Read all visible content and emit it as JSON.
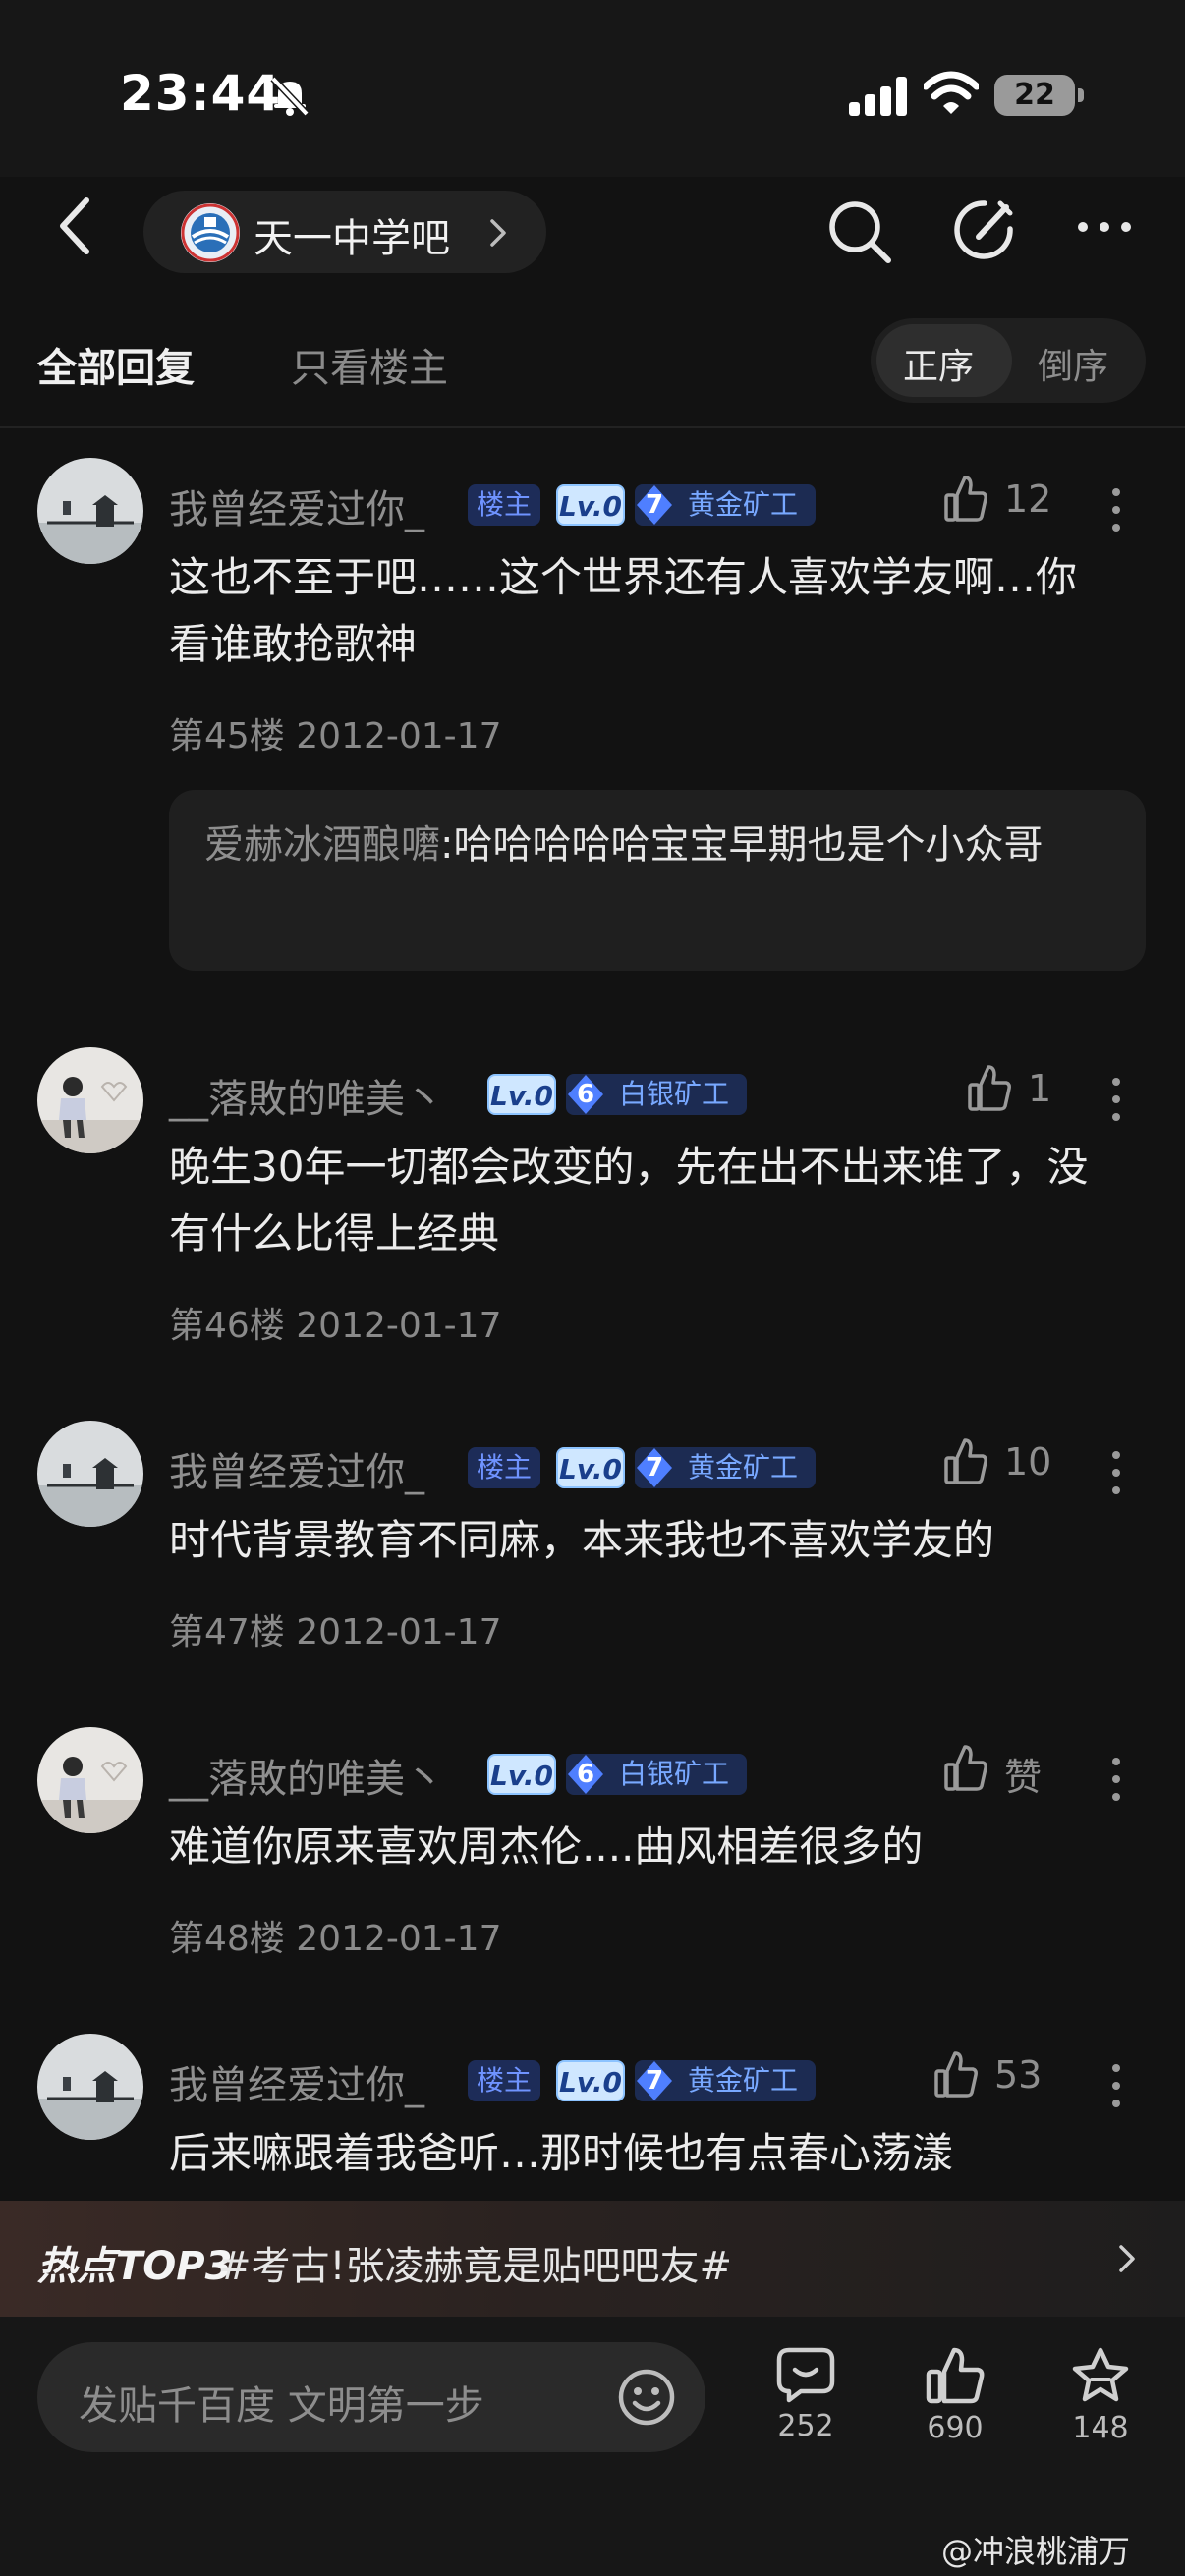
{
  "status_bar": {
    "time": "23:44",
    "battery": "22"
  },
  "header": {
    "forum_name": "天一中学吧"
  },
  "tabs": {
    "all_replies": "全部回复",
    "only_op": "只看楼主",
    "sort_asc": "正序",
    "sort_desc": "倒序",
    "active_sort": "正序"
  },
  "posts": [
    {
      "user": "我曾经爱过你_",
      "is_op": true,
      "op_badge": "楼主",
      "level": "Lv.0",
      "rank_num": "7",
      "rank_name": "黄金矿工",
      "likes": "12",
      "content": "这也不至于吧……这个世界还有人喜欢学友啊…你看谁敢抢歌神",
      "floor": "第45楼",
      "date": "2012-01-17",
      "sub_reply": {
        "user": "爱赫冰酒酿嚰",
        "sep": ":",
        "text": "哈哈哈哈哈宝宝早期也是个小众哥"
      }
    },
    {
      "user": "__落敗的唯美丶",
      "is_op": false,
      "level": "Lv.0",
      "rank_num": "6",
      "rank_name": "白银矿工",
      "likes": "1",
      "content": "晚生30年一切都会改变的，先在出不出来谁了，没有什么比得上经典",
      "floor": "第46楼",
      "date": "2012-01-17"
    },
    {
      "user": "我曾经爱过你_",
      "is_op": true,
      "op_badge": "楼主",
      "level": "Lv.0",
      "rank_num": "7",
      "rank_name": "黄金矿工",
      "likes": "10",
      "content": "时代背景教育不同麻，本来我也不喜欢学友的",
      "floor": "第47楼",
      "date": "2012-01-17"
    },
    {
      "user": "__落敗的唯美丶",
      "is_op": false,
      "level": "Lv.0",
      "rank_num": "6",
      "rank_name": "白银矿工",
      "likes": "赞",
      "content": "难道你原来喜欢周杰伦....曲风相差很多的",
      "floor": "第48楼",
      "date": "2012-01-17"
    },
    {
      "user": "我曾经爱过你_",
      "is_op": true,
      "op_badge": "楼主",
      "level": "Lv.0",
      "rank_num": "7",
      "rank_name": "黄金矿工",
      "likes": "53",
      "content": "后来嘛跟着我爸听…那时候也有点春心荡漾"
    }
  ],
  "hot_banner": {
    "tag": "热点TOP3",
    "title": "#考古!张凌赫竟是贴吧吧友#"
  },
  "bottom_bar": {
    "input_placeholder": "发贴千百度 文明第一步",
    "comments_count": "252",
    "likes_count": "690",
    "favorites_count": "148"
  },
  "watermark": "@冲浪桃浦万",
  "colors": {
    "background": "#121212",
    "accent_blue": "#6f93ff",
    "level_badge": "#cfe7ff"
  }
}
